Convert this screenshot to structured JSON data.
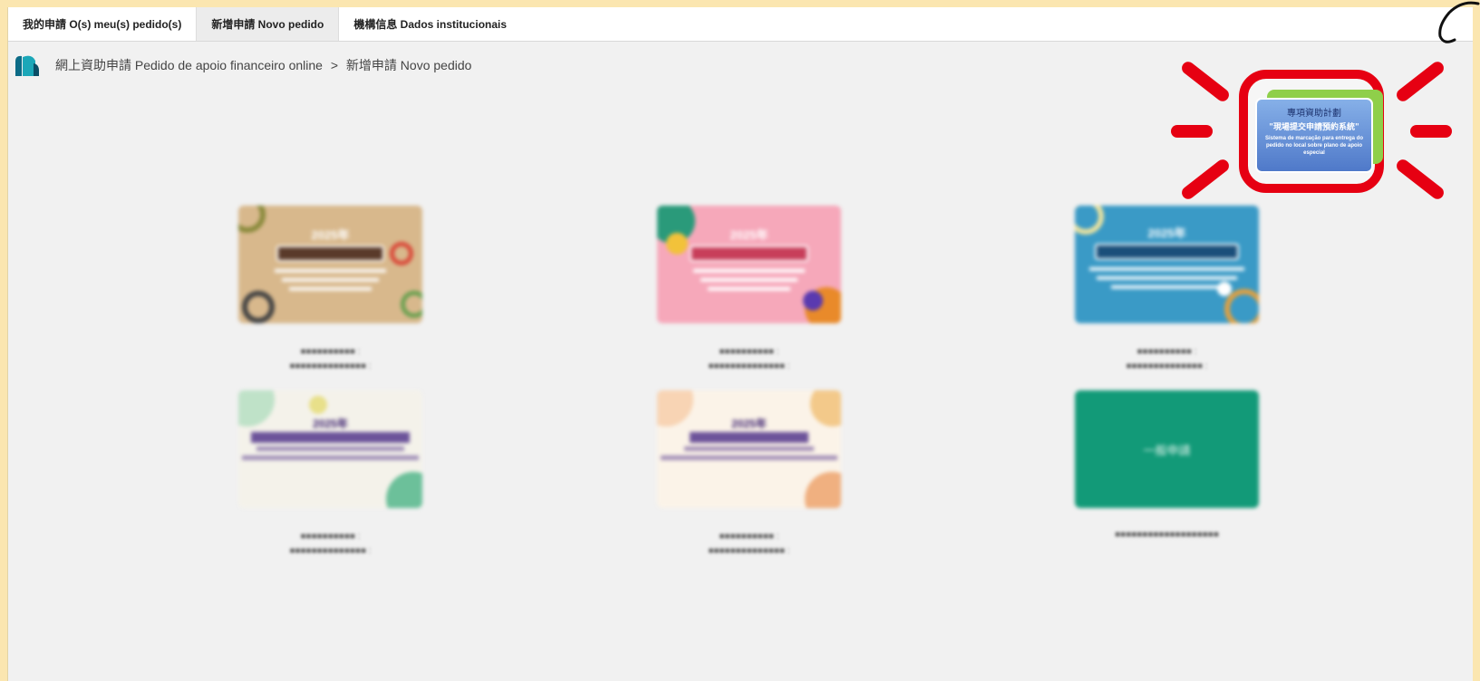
{
  "tabs": [
    {
      "label": "我的申請 O(s) meu(s) pedido(s)",
      "active": false
    },
    {
      "label": "新增申請 Novo pedido",
      "active": true
    },
    {
      "label": "機構信息 Dados institucionais",
      "active": false
    }
  ],
  "breadcrumb": {
    "root": "網上資助申請 Pedido de apoio financeiro online",
    "separator": ">",
    "current": "新增申請 Novo pedido"
  },
  "special_plan": {
    "title_zh": "專項資助計劃",
    "subtitle_zh": "\"現場提交申請預約系統\"",
    "subtitle_pt": "Sistema de marcação para entrega do pedido no local sobre plano de apoio especial"
  },
  "cards": [
    {
      "banner": "2025年",
      "caption_line1": "■■■■■■■■■■ :",
      "caption_line2": "■■■■■■■■■■■■■■ :"
    },
    {
      "banner": "2025年",
      "caption_line1": "■■■■■■■■■■ :",
      "caption_line2": "■■■■■■■■■■■■■■ :"
    },
    {
      "banner": "2025年",
      "caption_line1": "■■■■■■■■■■ :",
      "caption_line2": "■■■■■■■■■■■■■■ :"
    },
    {
      "banner": "2025年",
      "caption_line1": "■■■■■■■■■■ :",
      "caption_line2": "■■■■■■■■■■■■■■ :"
    },
    {
      "banner": "2025年",
      "caption_line1": "■■■■■■■■■■ :",
      "caption_line2": "■■■■■■■■■■■■■■ :"
    },
    {
      "banner": "一般申請",
      "caption_line1": "■■■■■■■■■■■■■■■■■■■",
      "caption_line2": ""
    }
  ],
  "colors": {
    "highlight": "#e60012",
    "general_card": "#129a78",
    "outer_bg": "#fbe6b0"
  }
}
